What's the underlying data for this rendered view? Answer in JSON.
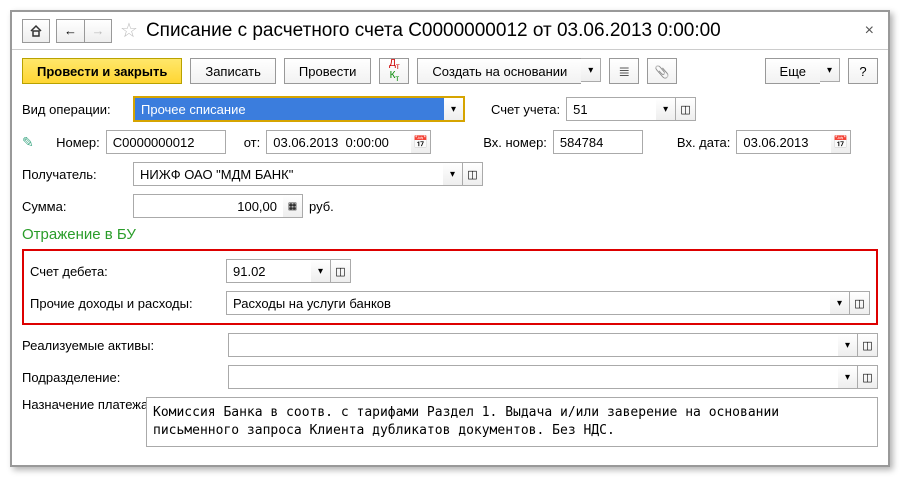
{
  "title": "Списание с расчетного счета C0000000012 от 03.06.2013 0:00:00",
  "toolbar": {
    "post_close": "Провести и закрыть",
    "save": "Записать",
    "post": "Провести",
    "create_based": "Создать на основании",
    "more": "Еще"
  },
  "labels": {
    "op_type": "Вид операции:",
    "account": "Счет учета:",
    "number": "Номер:",
    "from": "от:",
    "in_number": "Вх. номер:",
    "in_date": "Вх. дата:",
    "payee": "Получатель:",
    "sum": "Сумма:",
    "currency": "руб.",
    "section": "Отражение в БУ",
    "debit_acc": "Счет дебета:",
    "other_income": "Прочие доходы и расходы:",
    "assets": "Реализуемые активы:",
    "division": "Подразделение:",
    "purpose": "Назначение платежа:"
  },
  "values": {
    "op_type": "Прочее списание",
    "account": "51",
    "number": "C0000000012",
    "date": "03.06.2013  0:00:00",
    "in_number": "584784",
    "in_date": "03.06.2013",
    "payee": "НИЖФ ОАО \"МДМ БАНК\"",
    "sum": "100,00",
    "debit_acc": "91.02",
    "other_income": "Расходы на услуги банков",
    "assets": "",
    "division": "",
    "purpose": "Комиссия Банка в соотв. с тарифами Раздел 1. Выдача и/или заверение на основании письменного запроса Клиента дубликатов документов. Без НДС."
  }
}
